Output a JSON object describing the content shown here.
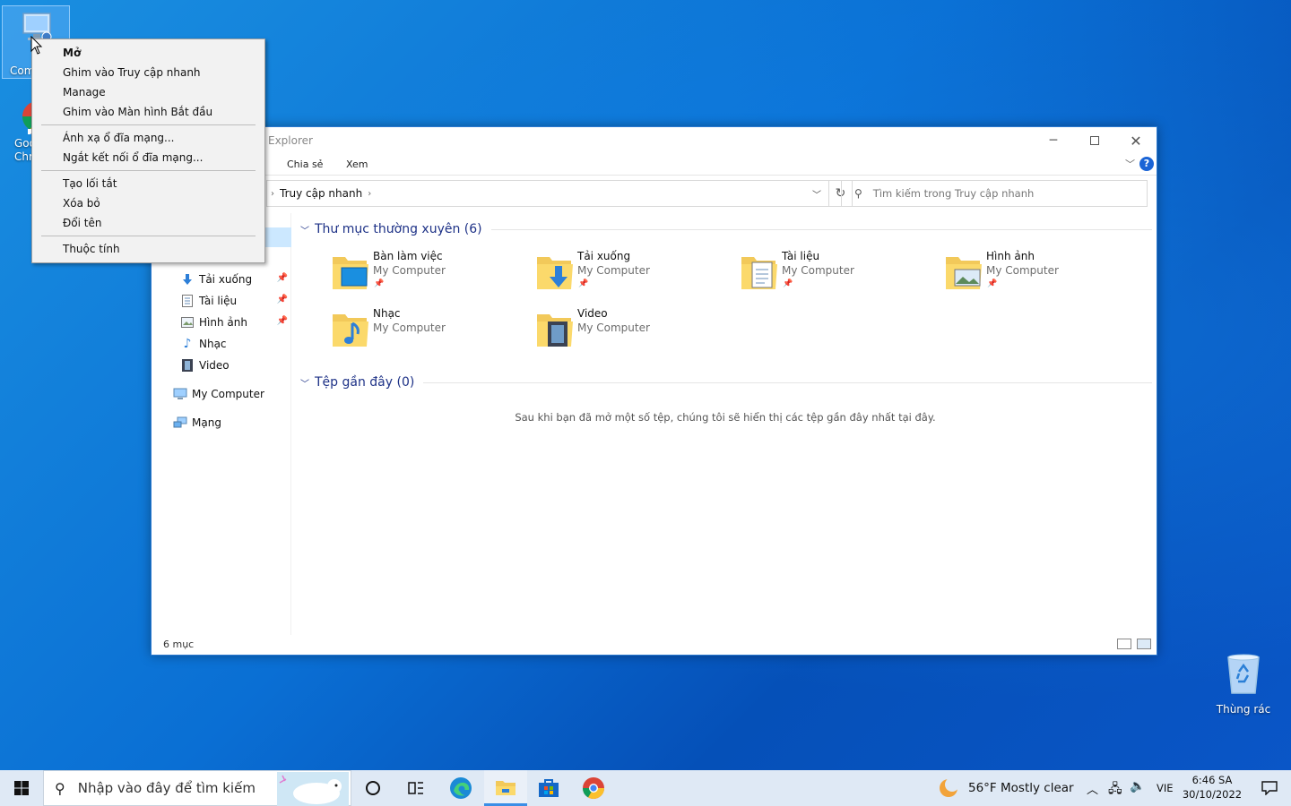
{
  "desktop": {
    "icons": {
      "my_computer": "My Computer",
      "my_computer_visible_partial": "Com",
      "chrome_line1": "Goo",
      "chrome_line2": "Chr",
      "recycle_bin": "Thùng rác"
    }
  },
  "context_menu": {
    "items": [
      {
        "label": "Mở"
      },
      {
        "label": "Ghim vào Truy cập nhanh"
      },
      {
        "label": "Manage"
      },
      {
        "label": "Ghim vào Màn hình Bắt đầu"
      },
      {
        "label": "Ánh xạ ổ đĩa mạng..."
      },
      {
        "label": "Ngắt kết nối ổ đĩa mạng..."
      },
      {
        "label": "Tạo lối tắt"
      },
      {
        "label": "Xóa bỏ"
      },
      {
        "label": "Đổi tên"
      },
      {
        "label": "Thuộc tính"
      }
    ]
  },
  "explorer": {
    "title_partial": "Explorer",
    "ribbon_tabs": [
      "Chia sẻ",
      "Xem"
    ],
    "help_label": "?",
    "address": {
      "crumb": "Truy cập nhanh"
    },
    "search_placeholder": "Tìm kiếm trong Truy cập nhanh",
    "nav": {
      "items": [
        {
          "label": "Tải xuống",
          "icon": "download-arrow-icon",
          "pinned": true
        },
        {
          "label": "Tài liệu",
          "icon": "document-icon",
          "pinned": true
        },
        {
          "label": "Hình ảnh",
          "icon": "pictures-icon",
          "pinned": true
        },
        {
          "label": "Nhạc",
          "icon": "music-note-icon",
          "pinned": false
        },
        {
          "label": "Video",
          "icon": "film-icon",
          "pinned": false
        }
      ],
      "my_computer": "My Computer",
      "network": "Mạng"
    },
    "frequent": {
      "header": "Thư mục thường xuyên (6)",
      "folders": [
        {
          "name": "Bàn làm việc",
          "location": "My Computer"
        },
        {
          "name": "Tải xuống",
          "location": "My Computer"
        },
        {
          "name": "Tài liệu",
          "location": "My Computer"
        },
        {
          "name": "Hình ảnh",
          "location": "My Computer"
        },
        {
          "name": "Nhạc",
          "location": "My Computer"
        },
        {
          "name": "Video",
          "location": "My Computer"
        }
      ]
    },
    "recent": {
      "header": "Tệp gần đây (0)",
      "empty_message": "Sau khi bạn đã mở một số tệp, chúng tôi sẽ hiển thị các tệp gần đây nhất tại đây."
    },
    "status": {
      "count": "6 mục"
    }
  },
  "taskbar": {
    "search_placeholder": "Nhập vào đây để tìm kiếm",
    "weather": {
      "temp": "56°F",
      "condition": "Mostly clear"
    },
    "language": "VIE",
    "time": "6:46 SA",
    "date": "30/10/2022"
  },
  "colors": {
    "accent": "#1a64d6",
    "group_header": "#1e3287",
    "taskbar_bg": "#dfe9f5"
  }
}
